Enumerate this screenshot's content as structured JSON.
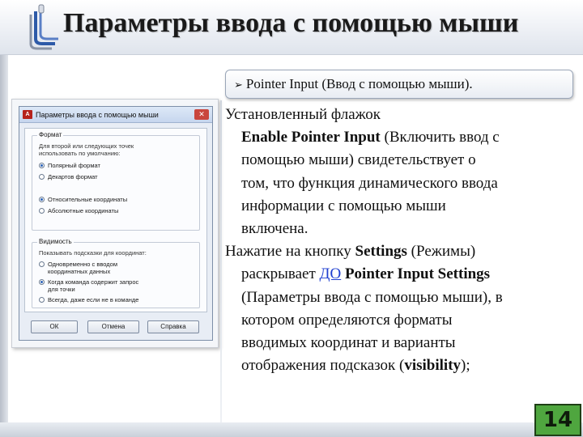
{
  "slide": {
    "title": "Параметры ввода с помощью мыши",
    "subtitle": "Pointer Input (Ввод с помощью мыши).",
    "page_number": "14"
  },
  "colors": {
    "page_badge": "#4fa63f",
    "link": "#1f3fd0"
  },
  "dialog": {
    "app_icon_text": "A",
    "title": "Параметры ввода с помощью мыши",
    "close_glyph": "✕",
    "format_group": {
      "label": "Формат",
      "desc_line1": "Для второй или следующих точек",
      "desc_line2": "использовать по умолчанию:",
      "options": [
        {
          "label": "Полярный формат",
          "selected": true
        },
        {
          "label": "Декартов формат",
          "selected": false
        },
        {
          "label": "Относительные координаты",
          "selected": true
        },
        {
          "label": "Абсолютные координаты",
          "selected": false
        }
      ]
    },
    "visibility_group": {
      "label": "Видимость",
      "desc": "Показывать подсказки для координат:",
      "options": [
        {
          "line1": "Одновременно с вводом",
          "line2": "координатных данных",
          "selected": false
        },
        {
          "line1": "Когда команда содержит запрос",
          "line2": "для точки",
          "selected": true
        },
        {
          "line1": "Всегда, даже если не в команде",
          "line2": "",
          "selected": false
        }
      ]
    },
    "buttons": {
      "ok": "ОК",
      "cancel": "Отмена",
      "help": "Справка"
    }
  },
  "body": {
    "p1_l1": "Установленный флажок",
    "p1_bold": "Enable Pointer Input",
    "p1_l2_rest": " (Включить ввод с",
    "p1_l3": "помощью мыши) свидетельствует о",
    "p1_l4": "том, что функция динамического ввода",
    "p1_l5": "информации с помощью мыши",
    "p1_l6": "включена.",
    "p2_l1_a": "Нажатие на кнопку ",
    "p2_l1_bold": "Settings",
    "p2_l1_b": " (Режимы)",
    "p2_l2_a": "раскрывает ",
    "p2_l2_link": "ДО",
    "p2_l2_bold": "Pointer Input Settings",
    "p2_l3": "(Параметры ввода с помощью мыши), в",
    "p2_l4": "котором определяются форматы",
    "p2_l5": "вводимых координат и варианты",
    "p2_l6_a": "отображения подсказок (",
    "p2_l6_bold": "visibility",
    "p2_l6_b": ");"
  }
}
